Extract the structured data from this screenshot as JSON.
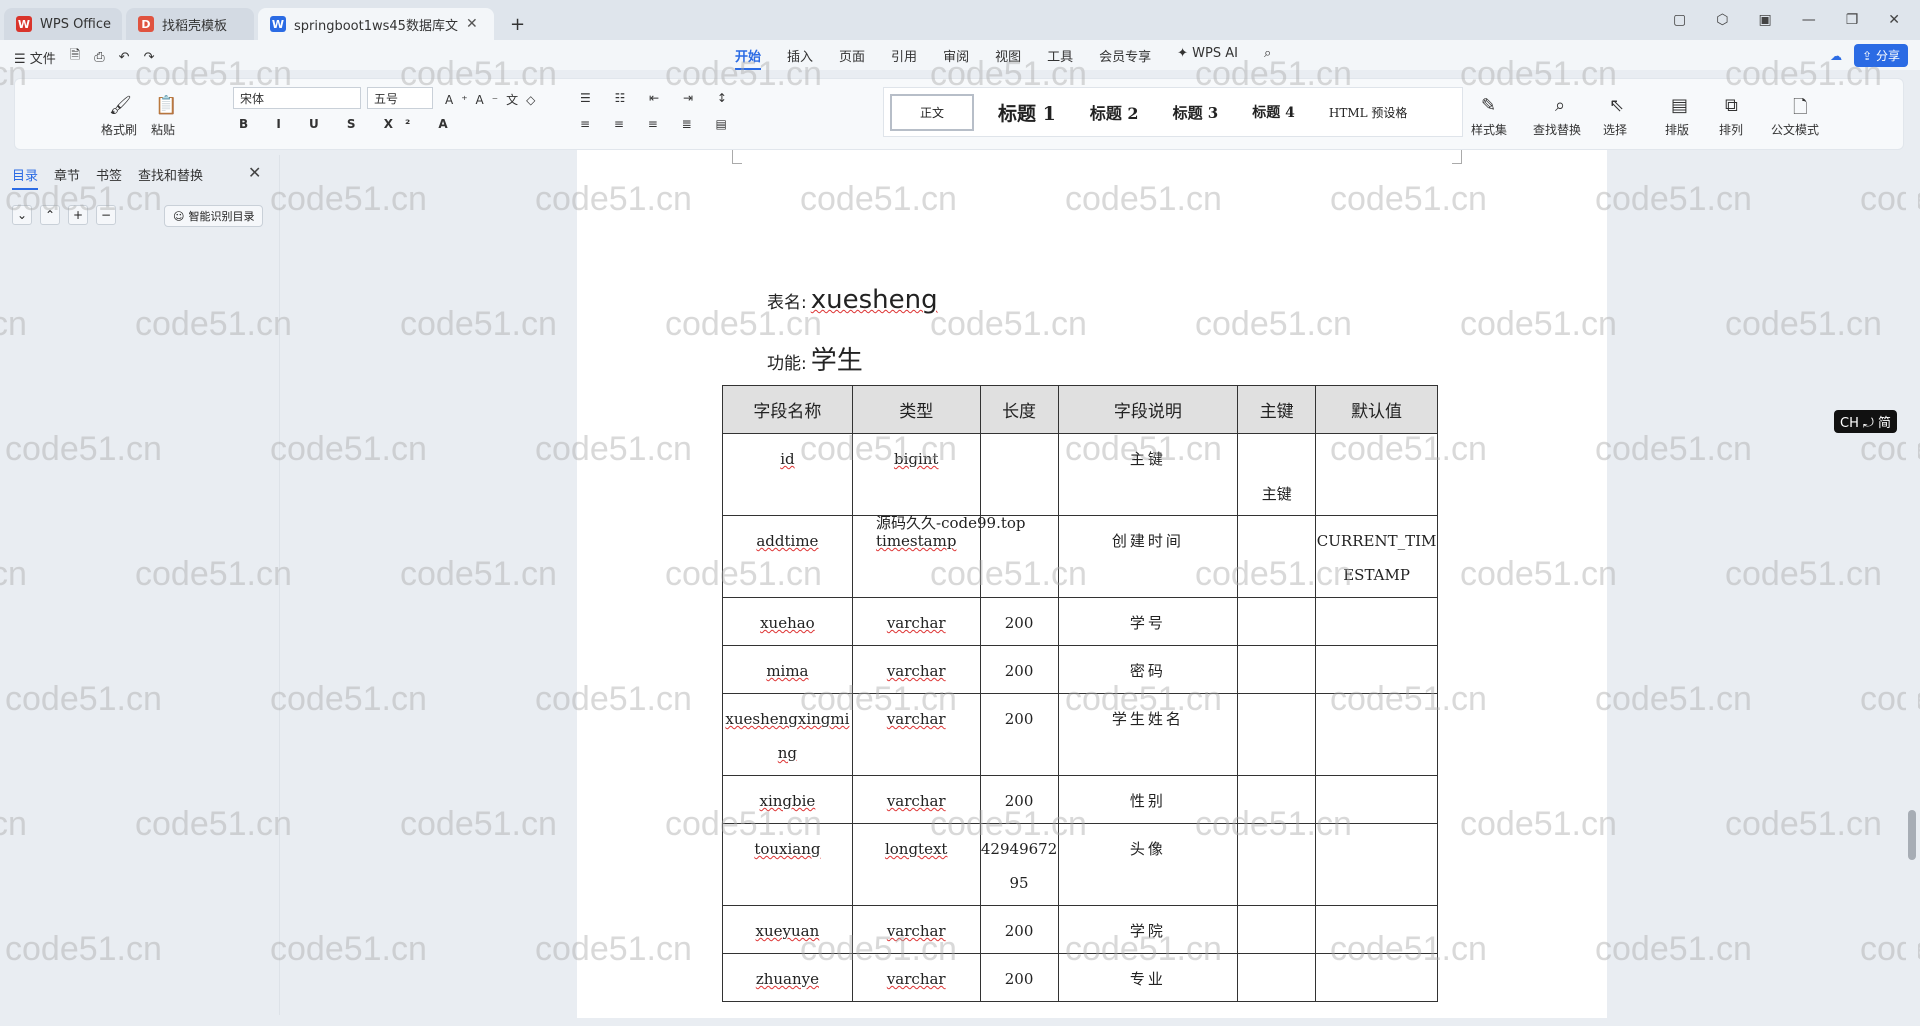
{
  "tabs": [
    {
      "label": "WPS Office",
      "icon": "wps-logo-icon",
      "color": "#d9342b"
    },
    {
      "label": "找稻壳模板",
      "icon": "docer-icon",
      "color": "#e0533f"
    },
    {
      "label": "springboot1ws45数据库文",
      "icon": "word-doc-icon",
      "color": "#2b6be4"
    }
  ],
  "window_controls": [
    "minimize-icon",
    "restore-icon",
    "close-icon"
  ],
  "menu": {
    "file": "文件",
    "tabs": [
      "开始",
      "插入",
      "页面",
      "引用",
      "审阅",
      "视图",
      "工具",
      "会员专享"
    ],
    "active_tab": "开始",
    "wps_ai": "WPS AI",
    "share": "分享"
  },
  "ribbon": {
    "format_painter": "格式刷",
    "paste": "粘贴",
    "font": "宋体",
    "size": "五号",
    "style_normal": "正文",
    "styles": [
      "标题 1",
      "标题 2",
      "标题 3",
      "标题 4",
      "HTML 预设格"
    ],
    "style_set": "样式集",
    "find_replace": "查找替换",
    "select": "选择",
    "sort": "排版",
    "arrange": "排列",
    "official": "公文模式"
  },
  "sidebar": {
    "tabs": [
      "目录",
      "章节",
      "书签",
      "查找和替换"
    ],
    "active": "目录",
    "smart_btn": "智能识别目录"
  },
  "doc": {
    "table_name_label": "表名:",
    "table_name": "xuesheng",
    "function_label": "功能:",
    "function": "学生",
    "overlay_text": "源码久久-code99.top",
    "headers": [
      "字段名称",
      "类型",
      "长度",
      "字段说明",
      "主键",
      "默认值"
    ],
    "rows": [
      [
        "id",
        "bigint",
        "",
        "主键",
        "主键",
        ""
      ],
      [
        "addtime",
        "timestamp",
        "",
        "创建时间",
        "",
        "CURRENT_TIMESTAMP"
      ],
      [
        "xuehao",
        "varchar",
        "200",
        "学号",
        "",
        ""
      ],
      [
        "mima",
        "varchar",
        "200",
        "密码",
        "",
        ""
      ],
      [
        "xueshengxingming",
        "varchar",
        "200",
        "学生姓名",
        "",
        ""
      ],
      [
        "xingbie",
        "varchar",
        "200",
        "性别",
        "",
        ""
      ],
      [
        "touxiang",
        "longtext",
        "4294967295",
        "头像",
        "",
        ""
      ],
      [
        "xueyuan",
        "varchar",
        "200",
        "学院",
        "",
        ""
      ],
      [
        "zhuanye",
        "varchar",
        "200",
        "专业",
        "",
        ""
      ]
    ]
  },
  "watermark": "code51.cn",
  "input_badge": "CH ⤾ 简"
}
